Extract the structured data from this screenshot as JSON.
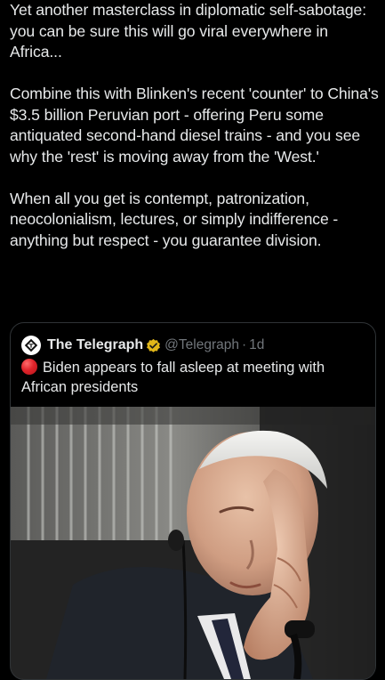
{
  "post": {
    "paragraphs": [
      "Yet another masterclass in diplomatic self-sabotage: you can be sure this will go viral everywhere in Africa...",
      "Combine this with Blinken's recent 'counter' to China's $3.5 billion Peruvian port - offering Peru some antiquated second-hand diesel trains - and you see why the 'rest' is moving away from the 'West.'",
      "When all you get is contempt, patronization, neocolonialism, lectures, or simply indifference - anything but respect - you guarantee division."
    ]
  },
  "quoted_post": {
    "author_name": "The Telegraph",
    "handle": "@Telegraph",
    "separator": "·",
    "time": "1d",
    "text": "Biden appears to fall asleep at meeting with African presidents",
    "icons": {
      "avatar": "telegraph-logo-icon",
      "verified": "gold-verified-badge-icon",
      "emoji": "red-circle-icon"
    }
  },
  "colors": {
    "background": "#000000",
    "text_primary": "#e7e9ea",
    "text_secondary": "#71767b",
    "card_border": "#2f3336",
    "verified_gold": "#e2b719"
  }
}
